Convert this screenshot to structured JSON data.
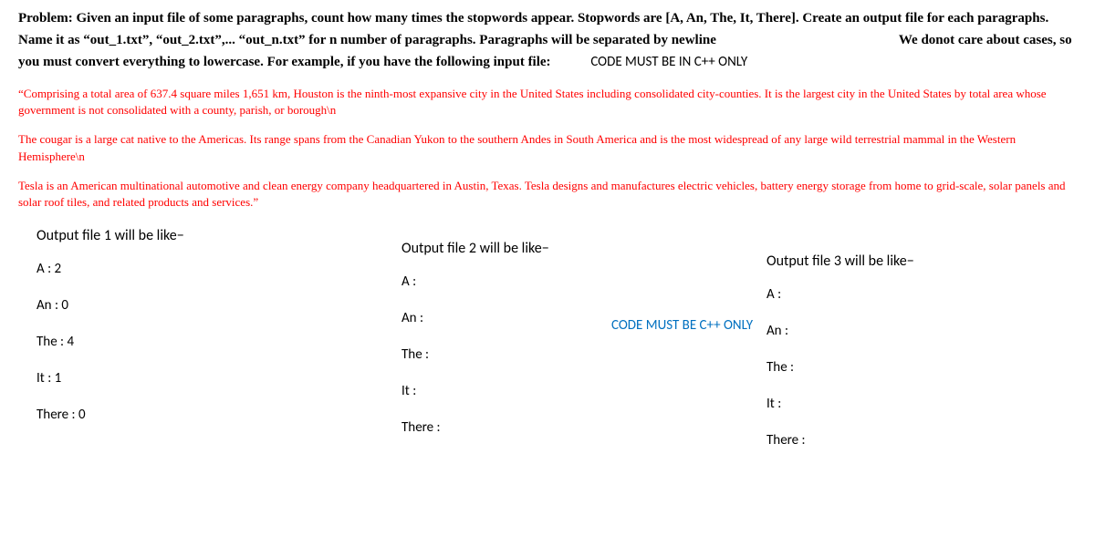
{
  "problem": {
    "line1": "Problem: Given an input file of some paragraphs, count how many times the stopwords appear. Stopwords are [A, An, The, It, There]. Create an output file for each paragraphs. Name it as “out_1.txt”, “out_2.txt”,... “out_n.txt” for n number of paragraphs. Paragraphs will be separated by newline",
    "line1b": "We donot care about cases, so you must convert everything to lowercase. For example, if you have the following input file:",
    "code_note_1": "CODE MUST BE IN C++ ONLY"
  },
  "examples": {
    "para1": "“Comprising a total area of 637.4 square miles 1,651 km, Houston is the ninth-most expansive city in the United States including consolidated city-counties. It is the largest city in the United States by total area whose government is not consolidated with a county, parish, or borough\\n",
    "para2": "The cougar is a large cat native to the Americas. Its range spans from the Canadian Yukon to the southern Andes in South America and is the most widespread of any large wild terrestrial mammal in the Western Hemisphere\\n",
    "para3": "Tesla is an American multinational automotive and clean energy company headquartered in Austin, Texas. Tesla designs and manufactures electric vehicles, battery energy storage from home to grid-scale, solar panels and solar roof tiles, and related products and services.”"
  },
  "code_note_2": "CODE MUST BE C++ ONLY",
  "outputs": [
    {
      "title": "Output file 1 will be like−",
      "lines": [
        "A : 2",
        "An : 0",
        "The : 4",
        "It : 1",
        "There : 0"
      ]
    },
    {
      "title": "Output file 2 will be like−",
      "lines": [
        "A :",
        "An :",
        "The :",
        "It :",
        "There :"
      ]
    },
    {
      "title": "Output file 3 will be like−",
      "lines": [
        "A :",
        "An :",
        "The :",
        "It :",
        "There :"
      ]
    }
  ]
}
